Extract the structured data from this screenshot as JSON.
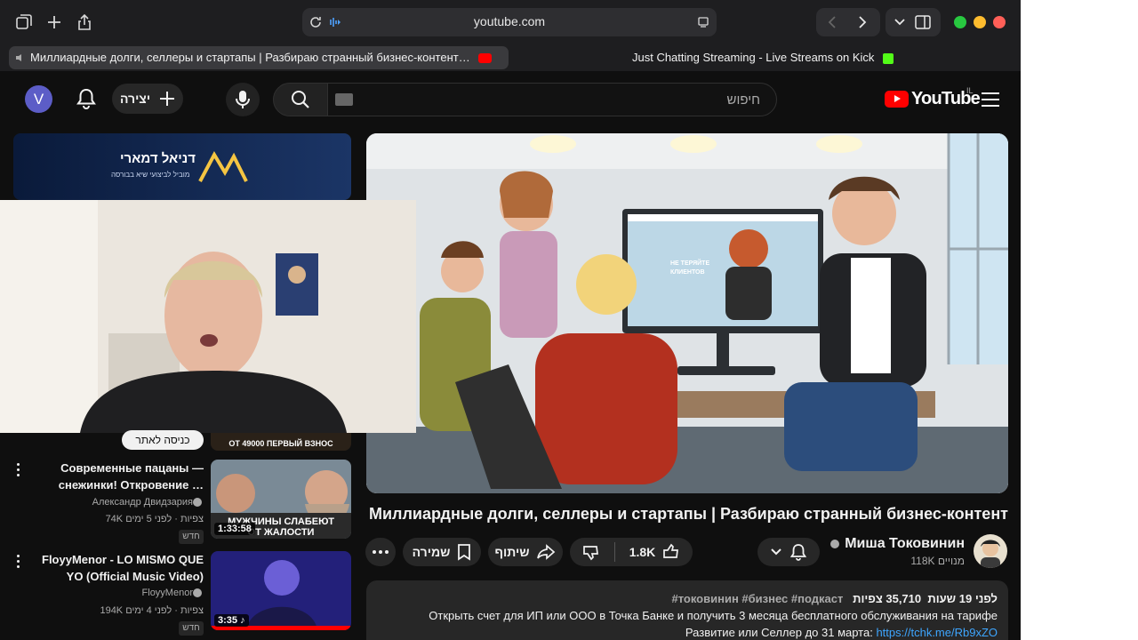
{
  "browser": {
    "url": "youtube.com",
    "tabs": [
      {
        "title": "Миллиардные долги, селлеры и стартапы | Разбираю странный бизнес-контент…",
        "active": true
      },
      {
        "title": "Just Chatting Streaming - Live Streams on Kick",
        "active": false
      }
    ],
    "traffic_colors": {
      "green": "#28c840",
      "yellow": "#febc2e",
      "red": "#ff5f57"
    }
  },
  "masthead": {
    "avatar_letter": "V",
    "create_label": "יצירה",
    "search_placeholder": "חיפוש",
    "logo_text": "YouTube",
    "country_code": "IL"
  },
  "video": {
    "title": "Миллиардные долги, селлеры и стартапы | Разбираю странный бизнес-контент",
    "channel": "Миша Токовинин",
    "subscribers": "118K מנויים",
    "likes": "1.8K",
    "share_label": "שיתוף",
    "save_label": "שמירה",
    "thumbnail_screen_text": "НЕ ТЕРЯЙТЕ КЛИЕНТОВ",
    "views": "35,710 צפיות",
    "time_ago": "לפני 19 שעות",
    "hashtags": "#токовинин #бизнес #подкаст",
    "description_line1": "Открыть счет для ИП или ООО в Точка Банке и получить 3 месяца бесплатного обслуживания на тарифе",
    "description_line2": "Развитие или Селлер до 31 марта:",
    "description_link": "https://tchk.me/Rb9xZO"
  },
  "sidebar": {
    "ad_title": "דניאל דמארי",
    "ad_subtitle": "מוביל לביצועי שיא בבורסה",
    "later_button": "כניסה לאתר",
    "partial_thumb_text": "ОТ 49000 ПЕРВЫЙ ВЗНОС",
    "recommendations": [
      {
        "title": "Современные пацаны — снежинки! Откровение …",
        "channel": "Александр Двидзария",
        "meta": "74K צפיות · לפני 5 ימים",
        "badge": "חדש",
        "duration": "1:33:58",
        "thumb_text": "МУЖЧИНЫ СЛАБЕЮТ ОТ ЖАЛОСТИ"
      },
      {
        "title": "FloyyMenor - LO MISMO QUE YO (Official Music Video)",
        "channel": "FloyyMenor",
        "meta": "194K צפיות · לפני 4 ימים",
        "badge": "חדש",
        "duration": "3:35"
      }
    ]
  },
  "colors": {
    "background": "#0f0f0f",
    "youtube_red": "#ff0000",
    "link_blue": "#3ea6ff",
    "kick_green": "#53fc18"
  }
}
